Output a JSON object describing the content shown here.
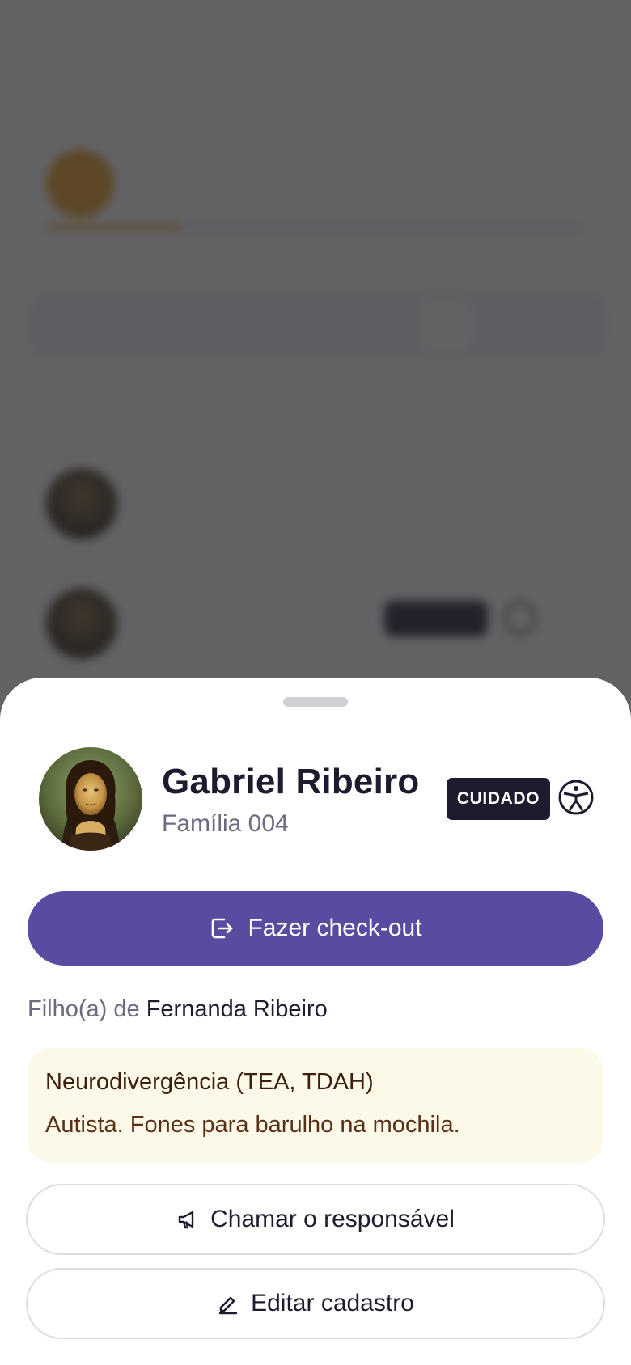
{
  "background": {
    "room": {
      "progress": 0.25
    }
  },
  "child": {
    "name": "Gabriel Ribeiro",
    "family": "Família 004",
    "badge": "CUIDADO",
    "parent_prefix": "Filho(a) de",
    "parent_name": "Fernanda Ribeiro"
  },
  "actions": {
    "checkout_label": "Fazer check-out",
    "call_label": "Chamar o responsável",
    "edit_label": "Editar cadastro"
  },
  "alert": {
    "title": "Neurodivergência (TEA, TDAH)",
    "body": "Autista. Fones para barulho na mochila."
  },
  "colors": {
    "primary": "#594b9f",
    "dark": "#1e1b2e",
    "alert_bg": "#fdf9e8",
    "room_accent": "#e8a021"
  },
  "icons": {
    "checkout": "checkout-icon",
    "accessibility": "accessibility-icon",
    "megaphone": "megaphone-icon",
    "edit": "pencil-icon"
  }
}
